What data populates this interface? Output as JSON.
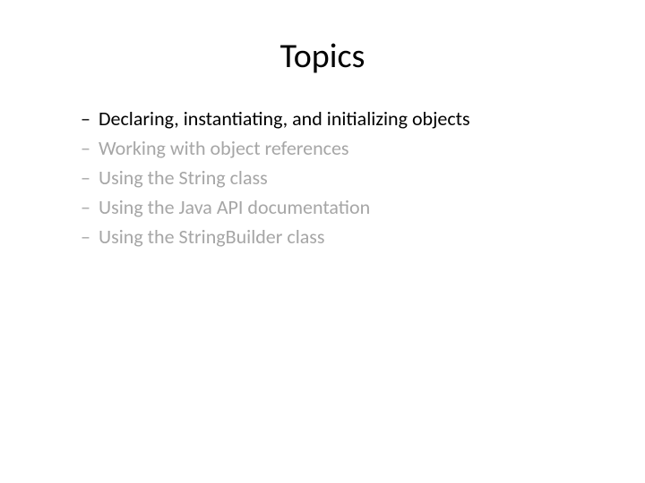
{
  "title": "Topics",
  "topics": [
    {
      "text": "Declaring, instantiating, and initializing objects",
      "active": true
    },
    {
      "text": "Working with object references",
      "active": false
    },
    {
      "text": "Using the String class",
      "active": false
    },
    {
      "text": "Using the Java API documentation",
      "active": false
    },
    {
      "text": "Using the StringBuilder class",
      "active": false
    }
  ]
}
